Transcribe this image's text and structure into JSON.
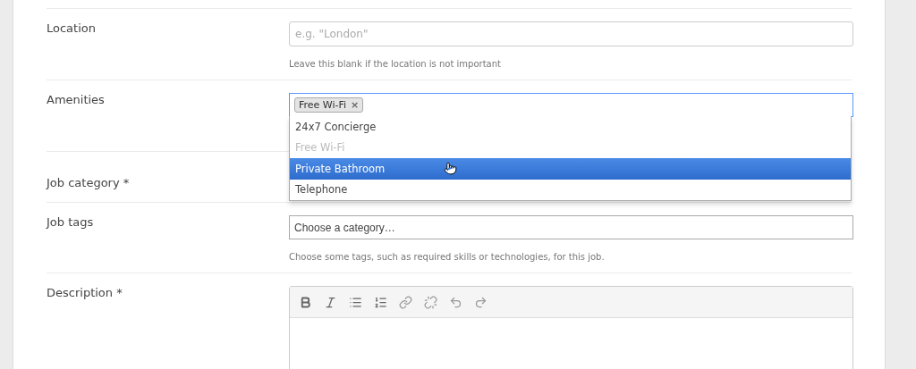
{
  "fields": [
    {
      "label": "Location",
      "kind": "text",
      "placeholder": "e.g. \"London\"",
      "hint": "Leave this blank if the location is not important"
    },
    {
      "label": "Amenities",
      "kind": "tags",
      "tags": [
        {
          "label": "Free Wi-Fi",
          "remove": "×"
        }
      ],
      "focused": true,
      "dropdown": [
        {
          "label": "24x7 Concierge",
          "selected": false,
          "disabled": false
        },
        {
          "label": "Free Wi-Fi",
          "selected": false,
          "disabled": true
        },
        {
          "label": "Private Bathroom",
          "selected": true,
          "disabled": false
        },
        {
          "label": "Telephone",
          "selected": false,
          "disabled": false
        }
      ]
    },
    {
      "label": "Job category *",
      "kind": "covered"
    },
    {
      "label": "Job tags",
      "kind": "select",
      "value": "Choose a category…",
      "hint": "Choose some tags, such as required skills or technologies, for this job."
    },
    {
      "label": "Description *",
      "kind": "editor",
      "tools": [
        {
          "kind": "bold"
        },
        {
          "kind": "italic"
        },
        {
          "kind": "bullets"
        },
        {
          "kind": "numbers"
        },
        {
          "kind": "link"
        },
        {
          "kind": "unlink"
        },
        {
          "kind": "undo"
        },
        {
          "kind": "redo"
        }
      ]
    }
  ]
}
